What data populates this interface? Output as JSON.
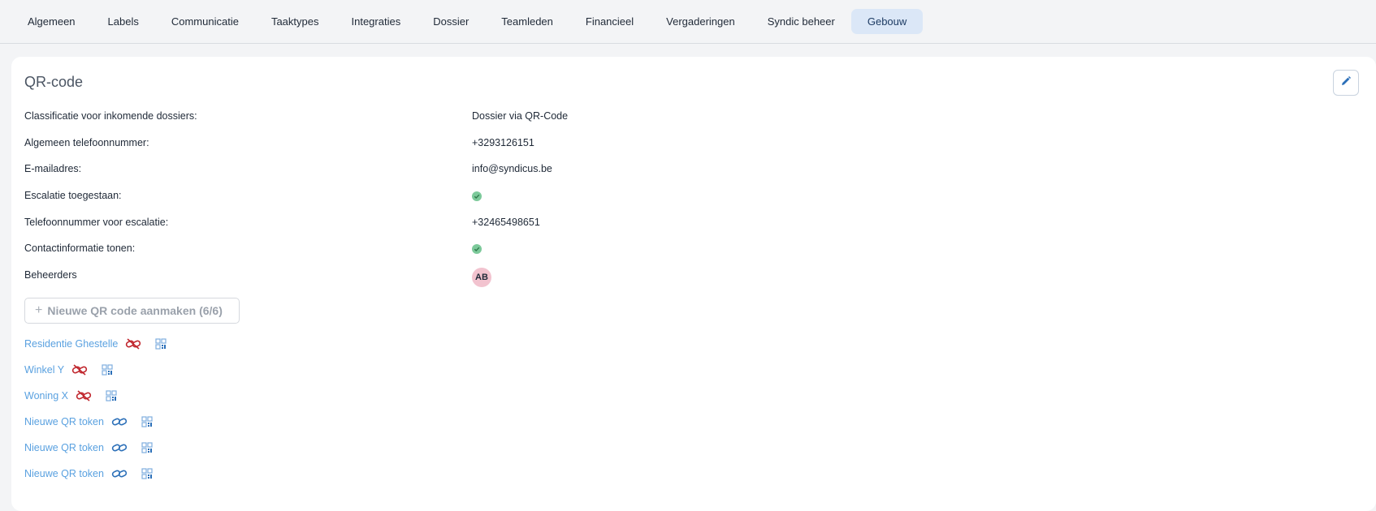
{
  "tabs": [
    {
      "label": "Algemeen",
      "active": false
    },
    {
      "label": "Labels",
      "active": false
    },
    {
      "label": "Communicatie",
      "active": false
    },
    {
      "label": "Taaktypes",
      "active": false
    },
    {
      "label": "Integraties",
      "active": false
    },
    {
      "label": "Dossier",
      "active": false
    },
    {
      "label": "Teamleden",
      "active": false
    },
    {
      "label": "Financieel",
      "active": false
    },
    {
      "label": "Vergaderingen",
      "active": false
    },
    {
      "label": "Syndic beheer",
      "active": false
    },
    {
      "label": "Gebouw",
      "active": true
    }
  ],
  "card": {
    "title": "QR-code",
    "edit_icon": "pencil-icon"
  },
  "fields": {
    "classificatie": {
      "label": "Classificatie voor inkomende dossiers:",
      "value": "Dossier via QR-Code"
    },
    "telefoon": {
      "label": "Algemeen telefoonnummer:",
      "value": "+3293126151"
    },
    "email": {
      "label": "E-mailadres:",
      "value": "info@syndicus.be"
    },
    "escalatie": {
      "label": "Escalatie toegestaan:",
      "value": true
    },
    "escalatie_telefoon": {
      "label": "Telefoonnummer voor escalatie:",
      "value": "+32465498651"
    },
    "contactinfo": {
      "label": "Contactinformatie tonen:",
      "value": true
    },
    "beheerders": {
      "label": "Beheerders",
      "avatar_initials": "AB"
    }
  },
  "new_button": {
    "label": "Nieuwe QR code aanmaken (6/6)"
  },
  "tokens": [
    {
      "name": "Residentie Ghestelle",
      "linked": false
    },
    {
      "name": "Winkel Y",
      "linked": false
    },
    {
      "name": "Woning X",
      "linked": false
    },
    {
      "name": "Nieuwe QR token",
      "linked": true
    },
    {
      "name": "Nieuwe QR token",
      "linked": true
    },
    {
      "name": "Nieuwe QR token",
      "linked": true
    }
  ],
  "colors": {
    "active_tab_bg": "#dbe7f7",
    "link_text": "#5aa1e0",
    "unlinked_icon": "#c0262d",
    "linked_icon": "#2b6fb8",
    "check_green": "#7cc99a",
    "avatar_bg": "#f2c3cf"
  }
}
